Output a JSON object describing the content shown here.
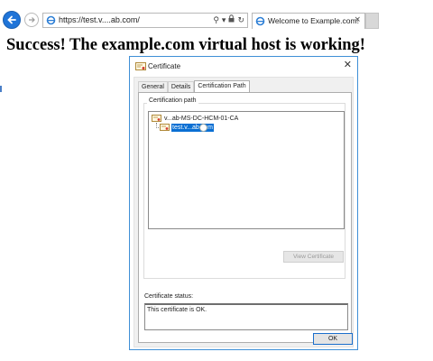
{
  "browser": {
    "back_icon": "back-arrow-icon",
    "forward_icon": "forward-arrow-icon",
    "address": "https://test.v....ab.com/",
    "address_tools": {
      "search": "⚲",
      "dropdown": "▾",
      "lock": "🔒",
      "refresh": "↻"
    },
    "tab_title": "Welcome to Example.com!",
    "tab_close": "×"
  },
  "page": {
    "heading": "Success! The example.com virtual host is working!"
  },
  "dialog": {
    "title": "Certificate",
    "close": "✕",
    "tabs": [
      {
        "label": "General",
        "active": false
      },
      {
        "label": "Details",
        "active": false
      },
      {
        "label": "Certification Path",
        "active": true
      }
    ],
    "certification_path_label": "Certification path",
    "tree": [
      {
        "label": "v...ab-MS-DC-HCM-01-CA",
        "selected": false
      },
      {
        "label": "test.v...ab.com",
        "selected": true
      }
    ],
    "view_certificate_button": "View Certificate",
    "status_label": "Certificate status:",
    "status_text": "This certificate is OK.",
    "ok_button": "OK"
  },
  "colors": {
    "accent": "#0a6fd3",
    "back_button": "#1f74d8",
    "dialog_border": "#3f8fd6"
  }
}
